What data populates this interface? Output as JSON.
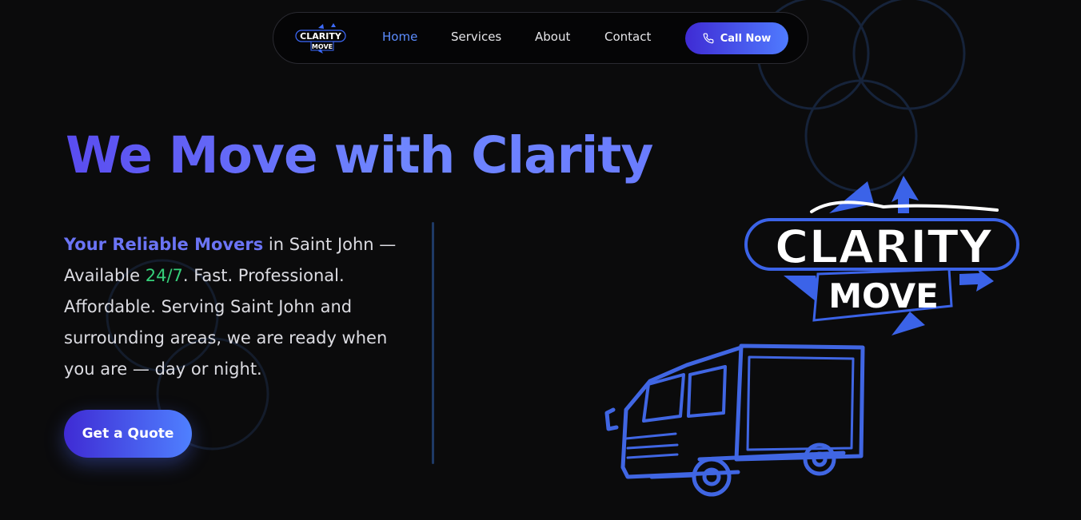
{
  "brand": {
    "logo_line1": "CLARITY",
    "logo_line2": "MOVE",
    "accent_color": "#4f80ff",
    "gradient_start": "#3f2bd4"
  },
  "nav": {
    "links": [
      "Home",
      "Services",
      "About",
      "Contact"
    ],
    "active": "Home",
    "call_label": "Call Now",
    "call_icon": "phone-icon"
  },
  "hero": {
    "title": "We Move with Clarity",
    "highlight": "Your Reliable Movers",
    "text_a": " in Saint John — Available ",
    "hours": "24/7",
    "text_b": ". Fast. Professional. Affordable. Serving Saint John and surrounding areas, we are ready when you are — day or night.",
    "cta_label": "Get a Quote"
  },
  "illustration": {
    "icon": "truck-icon"
  }
}
